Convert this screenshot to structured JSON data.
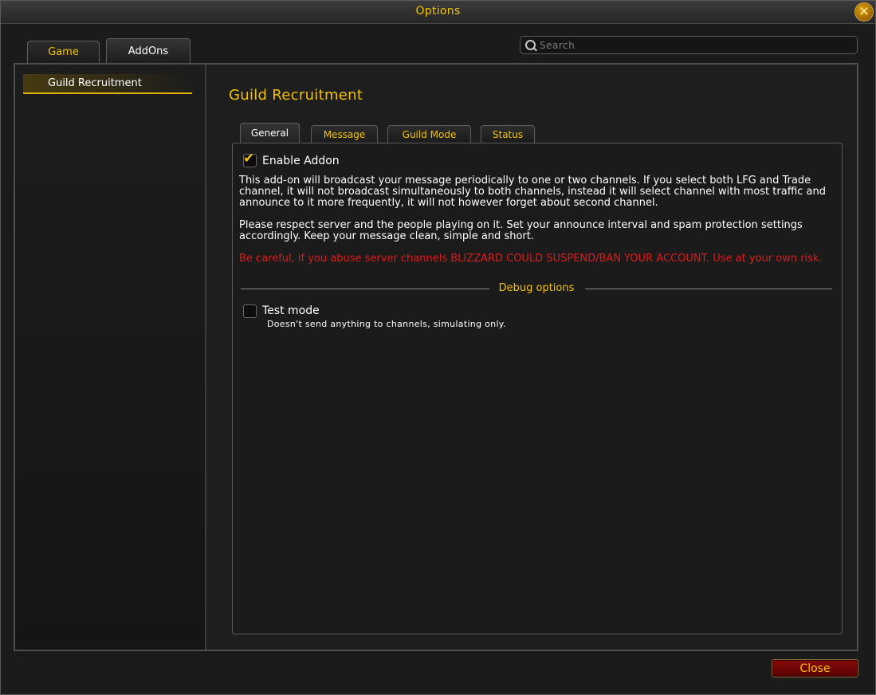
{
  "window": {
    "title": "Options",
    "close_icon": "close-x-icon"
  },
  "top_tabs": [
    {
      "label": "Game",
      "active": false
    },
    {
      "label": "AddOns",
      "active": true
    }
  ],
  "search": {
    "placeholder": "Search",
    "value": ""
  },
  "sidebar": {
    "items": [
      {
        "label": "Guild Recruitment",
        "selected": true
      }
    ]
  },
  "main": {
    "title": "Guild Recruitment",
    "tabs": [
      {
        "label": "General",
        "active": true
      },
      {
        "label": "Message",
        "active": false
      },
      {
        "label": "Guild Mode",
        "active": false
      },
      {
        "label": "Status",
        "active": false
      }
    ],
    "enable_addon": {
      "label": "Enable Addon",
      "checked": true
    },
    "description_1": "This add-on will broadcast your message periodically to one or two channels. If you select both LFG and Trade channel, it will not broadcast simultaneously to both channels, instead it will select channel with most traffic and announce to it more frequently, it will not however forget about second channel.",
    "description_2": "Please respect server and the people playing on it. Set your announce interval and spam protection settings accordingly. Keep your message clean, simple and short.",
    "warning": "Be careful, if you abuse server channels BLIZZARD COULD SUSPEND/BAN YOUR ACCOUNT. Use at your own risk.",
    "debug_header": "Debug options",
    "test_mode": {
      "label": "Test mode",
      "checked": false,
      "hint": "Doesn't send anything to channels, simulating only."
    }
  },
  "footer": {
    "close_label": "Close"
  },
  "colors": {
    "gold": "#f2c200",
    "warning_red": "#e01a1a",
    "close_button": "#8a0a0a"
  }
}
